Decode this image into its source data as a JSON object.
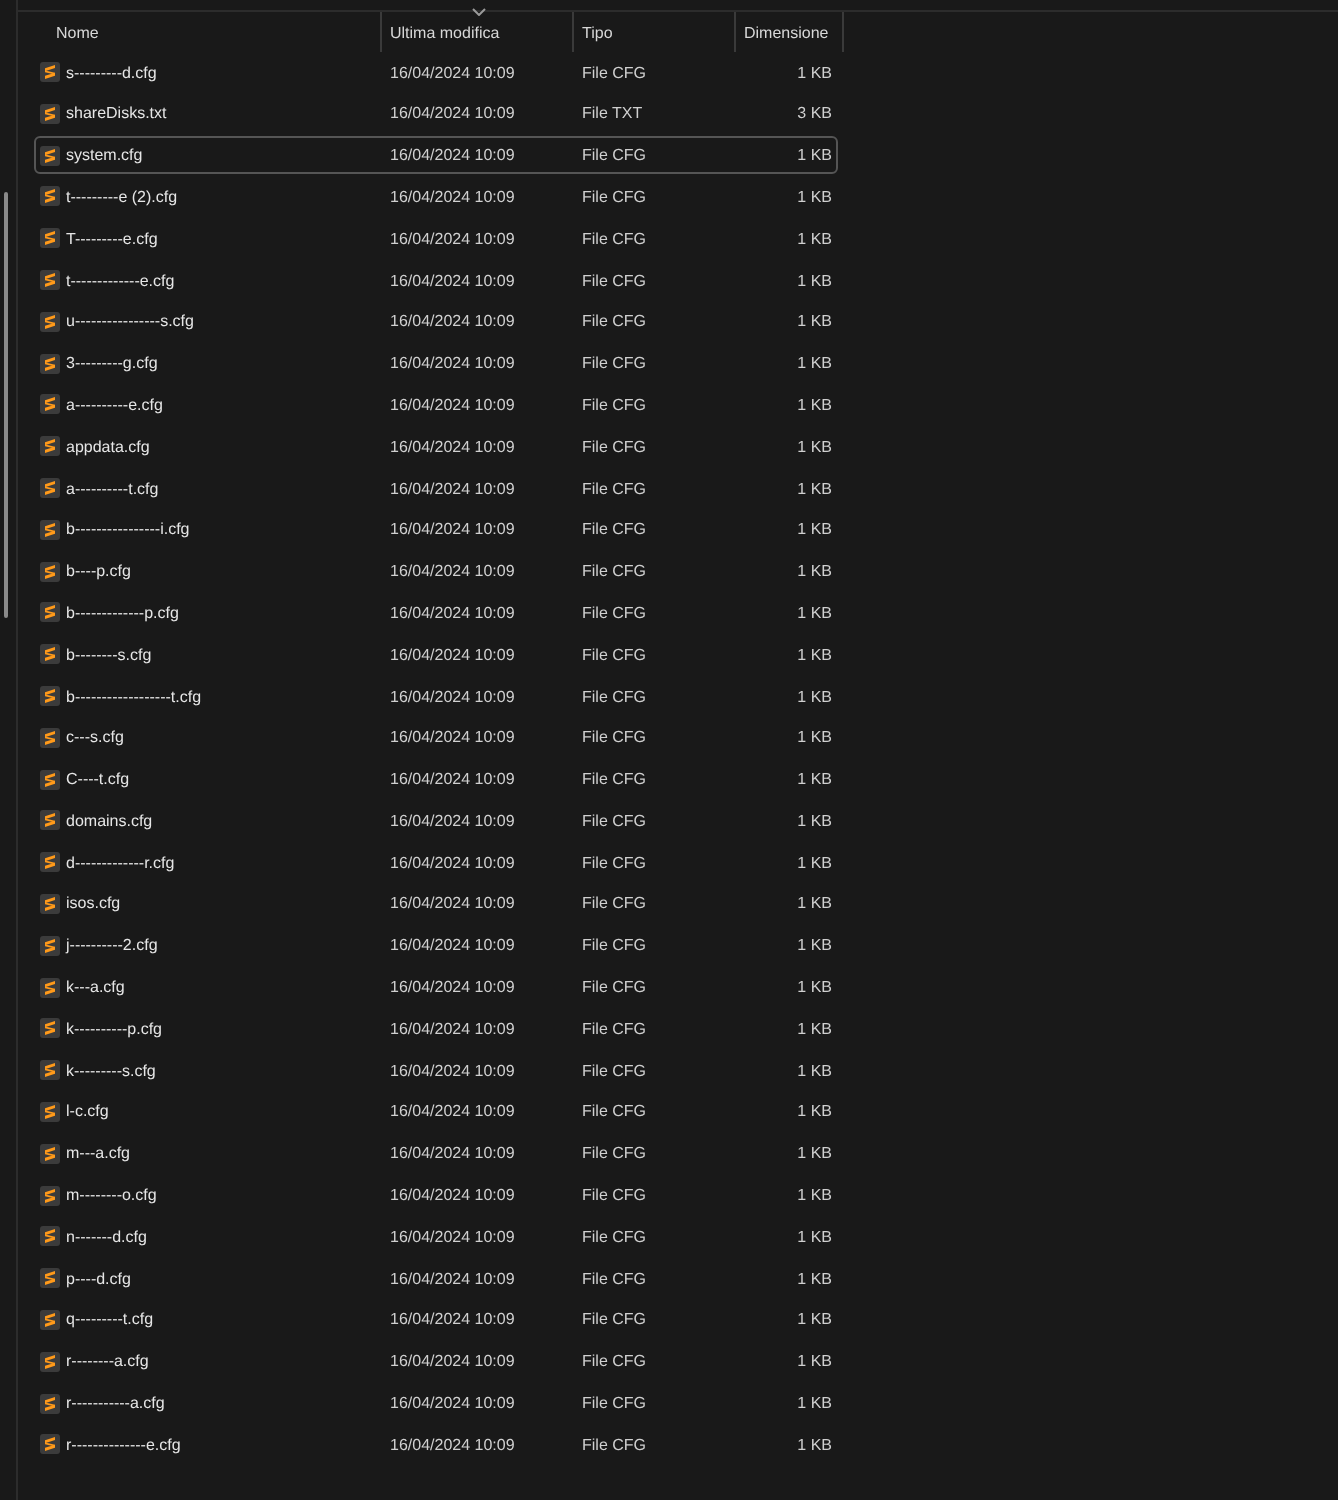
{
  "columns": [
    {
      "label": "Nome",
      "sorted": false
    },
    {
      "label": "Ultima modifica",
      "sorted": true
    },
    {
      "label": "Tipo",
      "sorted": false
    },
    {
      "label": "Dimensione",
      "sorted": false
    }
  ],
  "rows": [
    {
      "name": "s---------d.cfg",
      "modified": "16/04/2024 10:09",
      "type": "File CFG",
      "size": "1 KB",
      "focused": false
    },
    {
      "name": "shareDisks.txt",
      "modified": "16/04/2024 10:09",
      "type": "File TXT",
      "size": "3 KB",
      "focused": false
    },
    {
      "name": "system.cfg",
      "modified": "16/04/2024 10:09",
      "type": "File CFG",
      "size": "1 KB",
      "focused": true
    },
    {
      "name": "t---------e (2).cfg",
      "modified": "16/04/2024 10:09",
      "type": "File CFG",
      "size": "1 KB",
      "focused": false
    },
    {
      "name": "T---------e.cfg",
      "modified": "16/04/2024 10:09",
      "type": "File CFG",
      "size": "1 KB",
      "focused": false
    },
    {
      "name": "t-------------e.cfg",
      "modified": "16/04/2024 10:09",
      "type": "File CFG",
      "size": "1 KB",
      "focused": false
    },
    {
      "name": "u----------------s.cfg",
      "modified": "16/04/2024 10:09",
      "type": "File CFG",
      "size": "1 KB",
      "focused": false
    },
    {
      "name": "3---------g.cfg",
      "modified": "16/04/2024 10:09",
      "type": "File CFG",
      "size": "1 KB",
      "focused": false
    },
    {
      "name": "a----------e.cfg",
      "modified": "16/04/2024 10:09",
      "type": "File CFG",
      "size": "1 KB",
      "focused": false
    },
    {
      "name": "appdata.cfg",
      "modified": "16/04/2024 10:09",
      "type": "File CFG",
      "size": "1 KB",
      "focused": false
    },
    {
      "name": "a----------t.cfg",
      "modified": "16/04/2024 10:09",
      "type": "File CFG",
      "size": "1 KB",
      "focused": false
    },
    {
      "name": "b----------------i.cfg",
      "modified": "16/04/2024 10:09",
      "type": "File CFG",
      "size": "1 KB",
      "focused": false
    },
    {
      "name": "b----p.cfg",
      "modified": "16/04/2024 10:09",
      "type": "File CFG",
      "size": "1 KB",
      "focused": false
    },
    {
      "name": "b-------------p.cfg",
      "modified": "16/04/2024 10:09",
      "type": "File CFG",
      "size": "1 KB",
      "focused": false
    },
    {
      "name": "b--------s.cfg",
      "modified": "16/04/2024 10:09",
      "type": "File CFG",
      "size": "1 KB",
      "focused": false
    },
    {
      "name": "b------------------t.cfg",
      "modified": "16/04/2024 10:09",
      "type": "File CFG",
      "size": "1 KB",
      "focused": false
    },
    {
      "name": "c---s.cfg",
      "modified": "16/04/2024 10:09",
      "type": "File CFG",
      "size": "1 KB",
      "focused": false
    },
    {
      "name": "C----t.cfg",
      "modified": "16/04/2024 10:09",
      "type": "File CFG",
      "size": "1 KB",
      "focused": false
    },
    {
      "name": "domains.cfg",
      "modified": "16/04/2024 10:09",
      "type": "File CFG",
      "size": "1 KB",
      "focused": false
    },
    {
      "name": "d-------------r.cfg",
      "modified": "16/04/2024 10:09",
      "type": "File CFG",
      "size": "1 KB",
      "focused": false
    },
    {
      "name": "isos.cfg",
      "modified": "16/04/2024 10:09",
      "type": "File CFG",
      "size": "1 KB",
      "focused": false
    },
    {
      "name": "j----------2.cfg",
      "modified": "16/04/2024 10:09",
      "type": "File CFG",
      "size": "1 KB",
      "focused": false
    },
    {
      "name": "k---a.cfg",
      "modified": "16/04/2024 10:09",
      "type": "File CFG",
      "size": "1 KB",
      "focused": false
    },
    {
      "name": "k----------p.cfg",
      "modified": "16/04/2024 10:09",
      "type": "File CFG",
      "size": "1 KB",
      "focused": false
    },
    {
      "name": "k---------s.cfg",
      "modified": "16/04/2024 10:09",
      "type": "File CFG",
      "size": "1 KB",
      "focused": false
    },
    {
      "name": "l-c.cfg",
      "modified": "16/04/2024 10:09",
      "type": "File CFG",
      "size": "1 KB",
      "focused": false
    },
    {
      "name": "m---a.cfg",
      "modified": "16/04/2024 10:09",
      "type": "File CFG",
      "size": "1 KB",
      "focused": false
    },
    {
      "name": "m--------o.cfg",
      "modified": "16/04/2024 10:09",
      "type": "File CFG",
      "size": "1 KB",
      "focused": false
    },
    {
      "name": "n-------d.cfg",
      "modified": "16/04/2024 10:09",
      "type": "File CFG",
      "size": "1 KB",
      "focused": false
    },
    {
      "name": "p----d.cfg",
      "modified": "16/04/2024 10:09",
      "type": "File CFG",
      "size": "1 KB",
      "focused": false
    },
    {
      "name": "q---------t.cfg",
      "modified": "16/04/2024 10:09",
      "type": "File CFG",
      "size": "1 KB",
      "focused": false
    },
    {
      "name": "r--------a.cfg",
      "modified": "16/04/2024 10:09",
      "type": "File CFG",
      "size": "1 KB",
      "focused": false
    },
    {
      "name": "r-----------a.cfg",
      "modified": "16/04/2024 10:09",
      "type": "File CFG",
      "size": "1 KB",
      "focused": false
    },
    {
      "name": "r--------------e.cfg",
      "modified": "16/04/2024 10:09",
      "type": "File CFG",
      "size": "1 KB",
      "focused": false
    }
  ]
}
